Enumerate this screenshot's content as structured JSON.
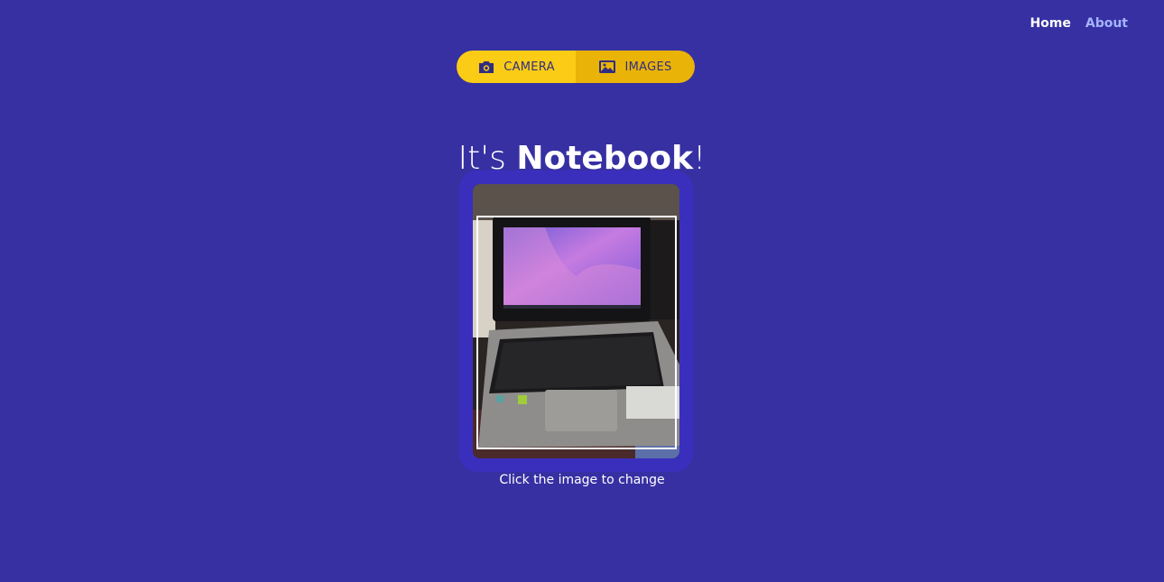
{
  "nav": {
    "home_label": "Home",
    "about_label": "About"
  },
  "mode_toggle": {
    "camera_label": "CAMERA",
    "camera_icon": "camera-icon",
    "images_label": "IMAGES",
    "images_icon": "image-icon",
    "active": "IMAGES"
  },
  "result": {
    "prefix": "It's ",
    "label": "Notebook",
    "suffix": "!"
  },
  "preview": {
    "caption": "Click the image to change"
  },
  "colors": {
    "background": "#3730a3",
    "card": "#3a2fbd",
    "toggle_camera": "#facc15",
    "toggle_images": "#eab308",
    "nav_active": "#ffffff",
    "nav_inactive": "#a5b4fc"
  }
}
